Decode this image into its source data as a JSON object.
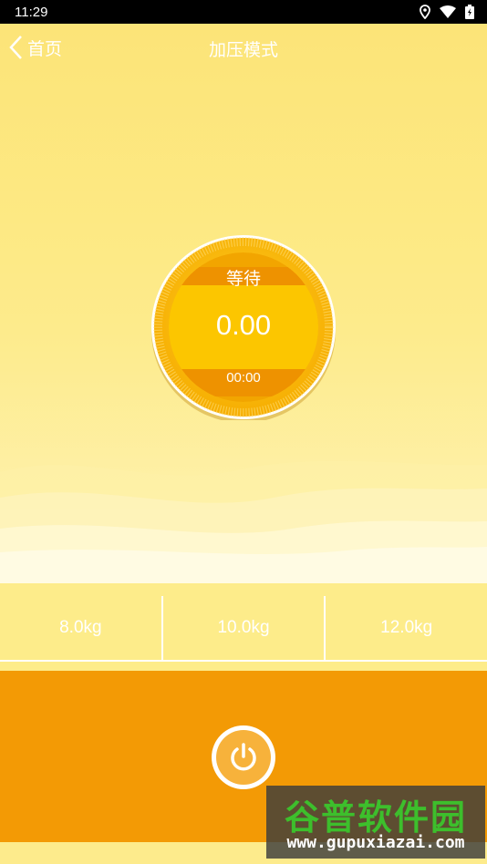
{
  "status_bar": {
    "time": "11:29",
    "icons": [
      "location-icon",
      "wifi-icon",
      "battery-icon"
    ]
  },
  "nav": {
    "back_label": "首页",
    "title": "加压模式"
  },
  "dial": {
    "status": "等待",
    "value": "0.00",
    "time": "00:00"
  },
  "weights": [
    "8.0kg",
    "10.0kg",
    "12.0kg"
  ],
  "power_button": {
    "icon": "power-icon"
  },
  "watermark": {
    "title": "谷普软件园",
    "url": "www.gupuxiazai.com"
  },
  "colors": {
    "accent": "#f39a05",
    "dial_gold": "#f7b500",
    "background": "#fbe37a"
  }
}
